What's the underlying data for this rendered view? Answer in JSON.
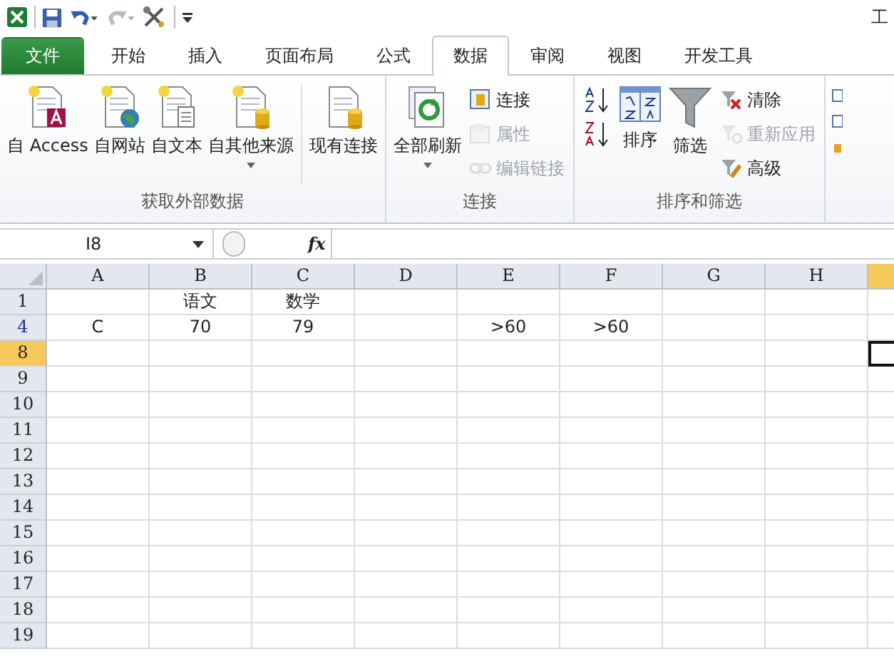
{
  "window": {
    "title": "工"
  },
  "tabs": [
    {
      "label": "文件",
      "kind": "file",
      "selected": false
    },
    {
      "label": "开始",
      "kind": "tab",
      "selected": false
    },
    {
      "label": "插入",
      "kind": "tab",
      "selected": false
    },
    {
      "label": "页面布局",
      "kind": "tab",
      "selected": false
    },
    {
      "label": "公式",
      "kind": "tab",
      "selected": false
    },
    {
      "label": "数据",
      "kind": "tab",
      "selected": true
    },
    {
      "label": "审阅",
      "kind": "tab",
      "selected": false
    },
    {
      "label": "视图",
      "kind": "tab",
      "selected": false
    },
    {
      "label": "开发工具",
      "kind": "tab",
      "selected": false
    }
  ],
  "ribbon_groups": [
    {
      "label": "获取外部数据",
      "items": [
        {
          "kind": "large",
          "label": "自 Access",
          "dropdown": false
        },
        {
          "kind": "large",
          "label": "自网站",
          "dropdown": false
        },
        {
          "kind": "large",
          "label": "自文本",
          "dropdown": false
        },
        {
          "kind": "large",
          "label": "自其他来源",
          "dropdown": true
        },
        {
          "kind": "separator"
        },
        {
          "kind": "large",
          "label": "现有连接",
          "dropdown": false
        }
      ]
    },
    {
      "label": "连接",
      "items": [
        {
          "kind": "large",
          "label": "全部刷新",
          "dropdown": true
        },
        {
          "kind": "stack",
          "items": [
            {
              "label": "连接",
              "disabled": false
            },
            {
              "label": "属性",
              "disabled": true
            },
            {
              "label": "编辑链接",
              "disabled": true
            }
          ]
        }
      ]
    },
    {
      "label": "排序和筛选",
      "items": [
        {
          "kind": "stack",
          "items": [
            {
              "disabled": false
            },
            {
              "disabled": false
            }
          ]
        },
        {
          "kind": "large",
          "label": "排序",
          "dropdown": false
        },
        {
          "kind": "large",
          "label": "筛选",
          "dropdown": false
        },
        {
          "kind": "stack",
          "items": [
            {
              "label": "清除",
              "disabled": false
            },
            {
              "label": "重新应用",
              "disabled": true
            },
            {
              "label": "高级",
              "disabled": false
            }
          ]
        }
      ]
    }
  ],
  "formula_bar": {
    "name_box": "I8",
    "function_label": "fx"
  },
  "columns": [
    {
      "label": "A",
      "selected": false
    },
    {
      "label": "B",
      "selected": false
    },
    {
      "label": "C",
      "selected": false
    },
    {
      "label": "D",
      "selected": false
    },
    {
      "label": "E",
      "selected": false
    },
    {
      "label": "F",
      "selected": false
    },
    {
      "label": "G",
      "selected": false
    },
    {
      "label": "H",
      "selected": false
    },
    {
      "selected": true
    }
  ],
  "rows": [
    {
      "label": "1",
      "selected": false,
      "filtered": false,
      "cells": [
        null,
        "语文",
        "数学"
      ]
    },
    {
      "label": "4",
      "selected": false,
      "filtered": true,
      "cells": [
        "C",
        "70",
        "79",
        null,
        ">60",
        ">60"
      ]
    },
    {
      "label": "8",
      "selected": true,
      "filtered": false,
      "cells": []
    },
    {
      "label": "9",
      "selected": false,
      "filtered": false,
      "cells": []
    },
    {
      "label": "10",
      "selected": false,
      "filtered": false,
      "cells": []
    },
    {
      "label": "11",
      "selected": false,
      "filtered": false,
      "cells": []
    },
    {
      "label": "12",
      "selected": false,
      "filtered": false,
      "cells": []
    },
    {
      "label": "13",
      "selected": false,
      "filtered": false,
      "cells": []
    },
    {
      "label": "14",
      "selected": false,
      "filtered": false,
      "cells": []
    },
    {
      "label": "15",
      "selected": false,
      "filtered": false,
      "cells": []
    },
    {
      "label": "16",
      "selected": false,
      "filtered": false,
      "cells": []
    },
    {
      "label": "17",
      "selected": false,
      "filtered": false,
      "cells": []
    },
    {
      "label": "18",
      "selected": false,
      "filtered": false,
      "cells": []
    },
    {
      "label": "19",
      "selected": false,
      "filtered": false,
      "cells": []
    }
  ]
}
